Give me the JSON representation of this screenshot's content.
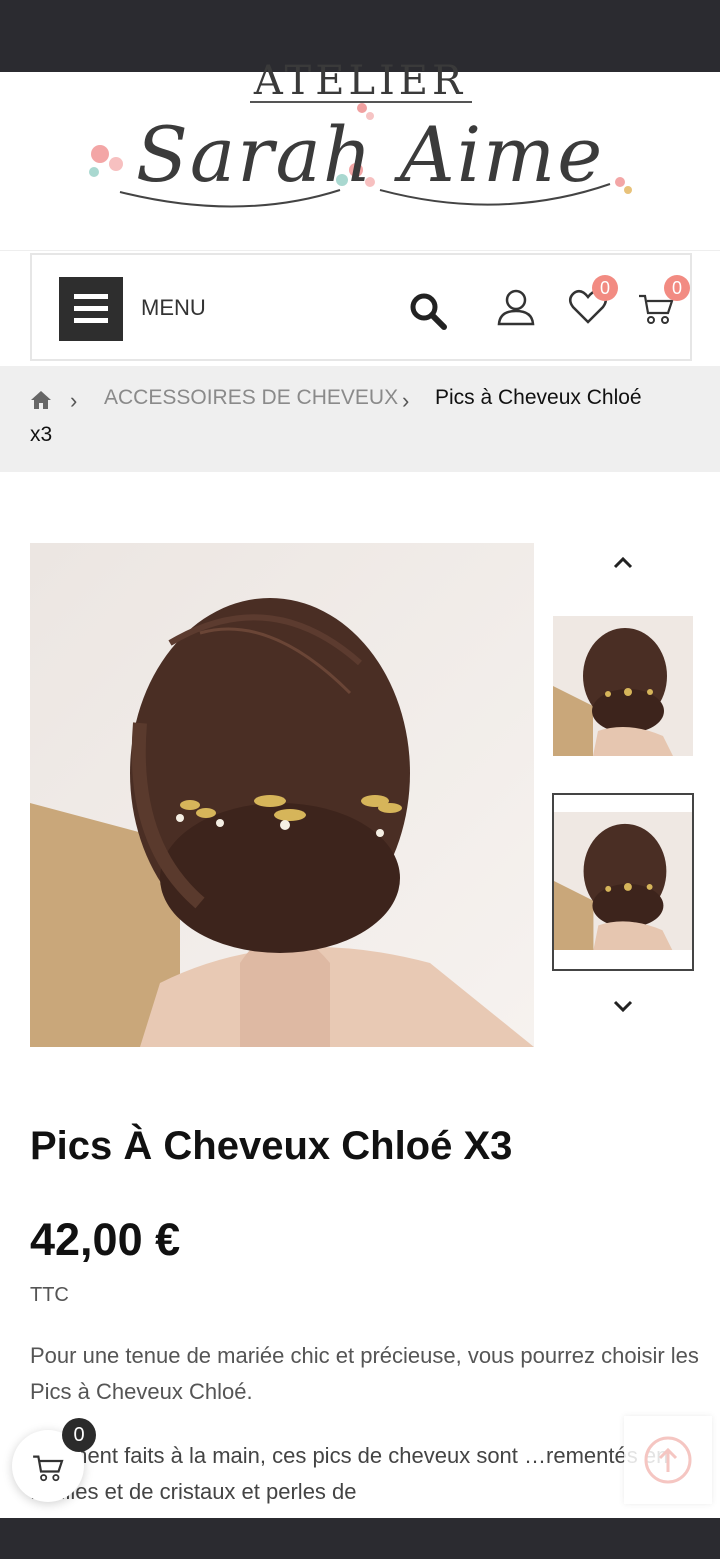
{
  "brand": {
    "top_text": "ATELIER",
    "script_text": "Sarah Aime"
  },
  "nav": {
    "menu_label": "MENU",
    "wishlist_count": "0",
    "cart_count": "0",
    "icons": [
      "hamburger-icon",
      "search-icon",
      "user-icon",
      "heart-icon",
      "cart-icon"
    ]
  },
  "breadcrumb": {
    "home_icon": "home-icon",
    "category": "ACCESSOIRES DE CHEVEUX",
    "current_line1": "Pics à Cheveux Chloé",
    "current_line2": "x3",
    "separator": "›"
  },
  "product": {
    "title": "Pics À Cheveux Chloé X3",
    "price": "42,00 €",
    "tax_label": "TTC",
    "description_p1": "Pour une tenue de mariée chic et précieuse, vous pourrez choisir les Pics à Cheveux Chloé.",
    "description_p2": "…lement faits à la main, ces pics de cheveux sont …rementés en feuilles et de cristaux et perles de"
  },
  "floating": {
    "cart_count": "0"
  },
  "colors": {
    "accent_badge": "#f28b82",
    "dark": "#2b2b30",
    "breadcrumb_bg": "#efefef"
  }
}
